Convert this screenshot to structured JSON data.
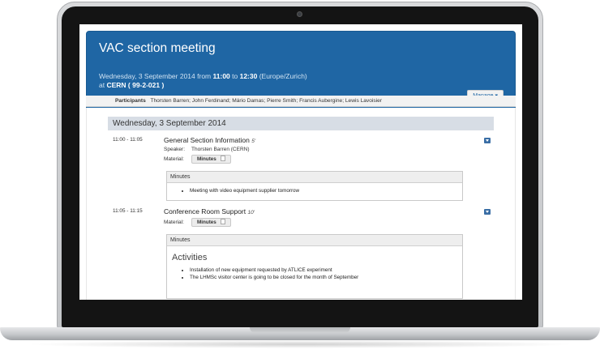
{
  "event": {
    "title": "VAC section meeting",
    "date_prefix": "Wednesday, 3 September 2014 from ",
    "start": "11:00",
    "to": " to ",
    "end": "12:30",
    "timezone": " (Europe/Zurich)",
    "at": "at ",
    "room": "CERN ( 99-2-021 )"
  },
  "toolbar": {
    "manage_label": "Manage ▾"
  },
  "participants": {
    "label": "Participants",
    "names": "Thorsten Barren; John Ferdinand; Mário Damas; Pierre Smith; Francis Aubergine; Lewis Lavoisier"
  },
  "day_header": "Wednesday, 3 September 2014",
  "contributions": [
    {
      "time": "11:00 - 11:05",
      "title": "General Section Information",
      "duration": "5'",
      "speaker_label": "Speaker:",
      "speaker": "Thorsten Barren (CERN)",
      "material_label": "Material:",
      "material_button": "Minutes",
      "minutes_header": "Minutes",
      "minutes_items": [
        "Meeting with video equipment supplier tomorrow"
      ]
    },
    {
      "time": "11:05 - 11:15",
      "title": "Conference Room Support",
      "duration": "10'",
      "material_label": "Material:",
      "material_button": "Minutes",
      "minutes_header": "Minutes",
      "activities_heading": "Activities",
      "minutes_items": [
        "Installation of new equipment requested by ATLICE experiment",
        "The LHMSc visitor center is going to be closed for the month of September"
      ]
    }
  ],
  "colors": {
    "header_blue": "#1f66a4",
    "day_header_bg": "#d7dde5"
  }
}
